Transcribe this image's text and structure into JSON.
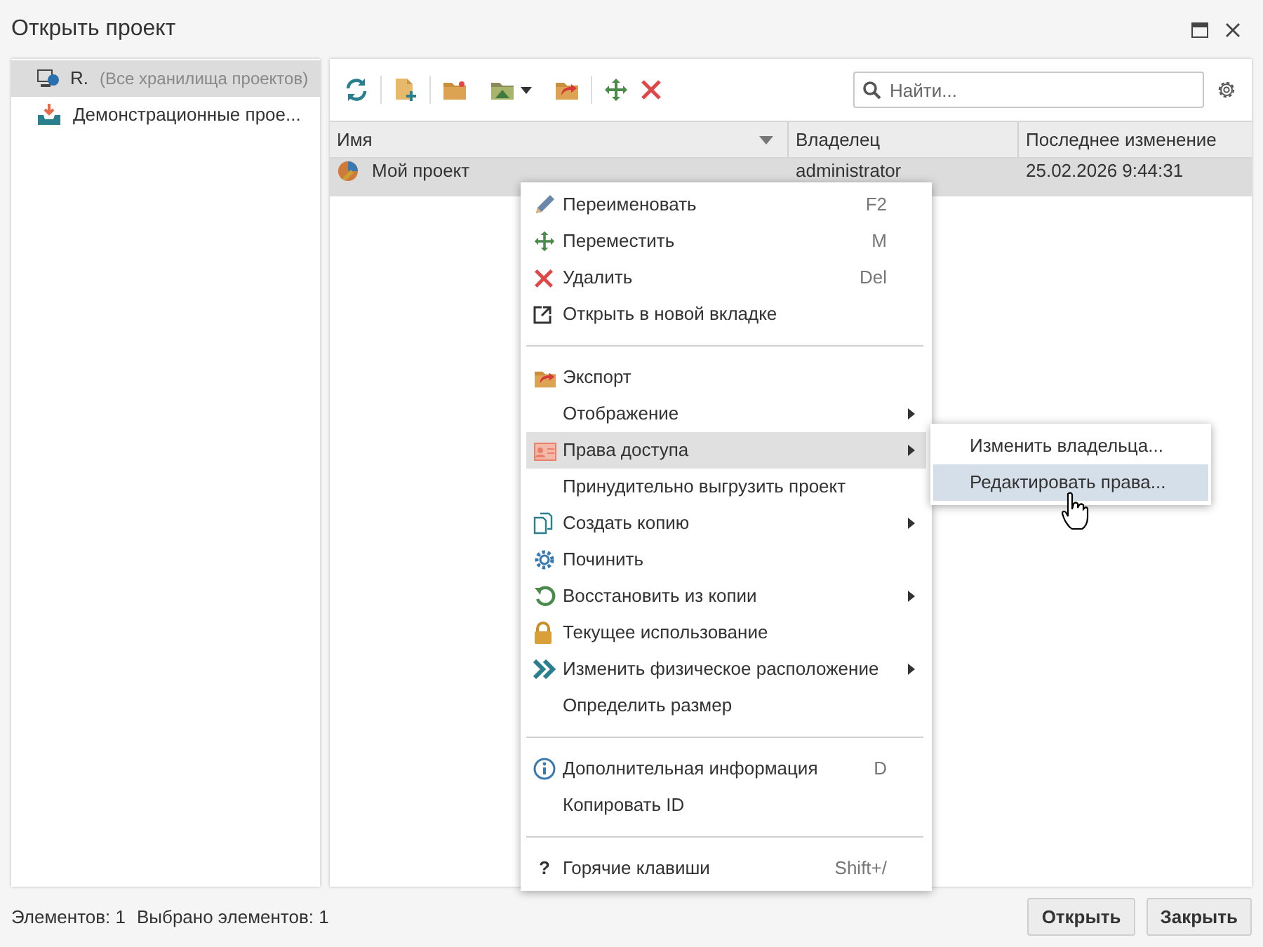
{
  "window": {
    "title": "Открыть проект"
  },
  "sidebar": {
    "items": [
      {
        "label": "R.",
        "note": "(Все хранилища проектов)",
        "selected": true
      },
      {
        "label": "Демонстрационные прое...",
        "selected": false
      }
    ]
  },
  "search": {
    "placeholder": "Найти..."
  },
  "table": {
    "columns": [
      {
        "label": "Имя",
        "sorted": true
      },
      {
        "label": "Владелец",
        "sorted": false
      },
      {
        "label": "Последнее изменение",
        "sorted": false
      }
    ],
    "rows": [
      {
        "cells": [
          "Мой проект",
          "administrator",
          "25.02.2026 9:44:31"
        ],
        "selected": true
      }
    ]
  },
  "context_menu": {
    "items": [
      {
        "kind": "item",
        "label": "Переименовать",
        "shortcut": "F2",
        "submenu": false,
        "selected": false
      },
      {
        "kind": "item",
        "label": "Переместить",
        "shortcut": "M",
        "submenu": false,
        "selected": false
      },
      {
        "kind": "item",
        "label": "Удалить",
        "shortcut": "Del",
        "submenu": false,
        "selected": false
      },
      {
        "kind": "item",
        "label": "Открыть в новой вкладке",
        "submenu": false,
        "selected": false
      },
      {
        "kind": "separator"
      },
      {
        "kind": "item",
        "label": "Экспорт",
        "submenu": false,
        "selected": false
      },
      {
        "kind": "item",
        "label": "Отображение",
        "submenu": true,
        "selected": false
      },
      {
        "kind": "item",
        "label": "Права доступа",
        "submenu": true,
        "selected": true
      },
      {
        "kind": "item",
        "label": "Принудительно выгрузить проект",
        "submenu": false,
        "selected": false
      },
      {
        "kind": "item",
        "label": "Создать копию",
        "submenu": true,
        "selected": false
      },
      {
        "kind": "item",
        "label": "Починить",
        "submenu": false,
        "selected": false
      },
      {
        "kind": "item",
        "label": "Восстановить из копии",
        "submenu": true,
        "selected": false
      },
      {
        "kind": "item",
        "label": "Текущее использование",
        "submenu": false,
        "selected": false
      },
      {
        "kind": "item",
        "label": "Изменить физическое расположение",
        "submenu": true,
        "selected": false
      },
      {
        "kind": "item",
        "label": "Определить размер",
        "submenu": false,
        "selected": false
      },
      {
        "kind": "separator"
      },
      {
        "kind": "item",
        "label": "Дополнительная информация",
        "shortcut": "D",
        "submenu": false,
        "selected": false
      },
      {
        "kind": "item",
        "label": "Копировать ID",
        "submenu": false,
        "selected": false
      },
      {
        "kind": "separator"
      },
      {
        "kind": "item",
        "label": "Горячие клавиши",
        "shortcut": "Shift+/",
        "glyph": "?",
        "submenu": false,
        "selected": false
      }
    ]
  },
  "submenu": {
    "items": [
      {
        "label": "Изменить владельца...",
        "selected": false
      },
      {
        "label": "Редактировать права...",
        "selected": true
      }
    ]
  },
  "status_bar": {
    "count": "Элементов: 1",
    "selected_count": "Выбрано элементов: 1"
  },
  "buttons": [
    {
      "label": "Открыть"
    },
    {
      "label": "Закрыть"
    }
  ]
}
